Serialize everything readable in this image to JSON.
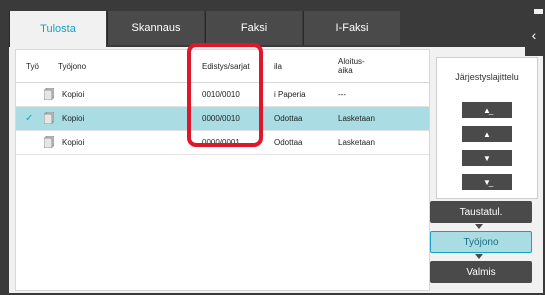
{
  "tabs": [
    "Tulosta",
    "Skannaus",
    "Faksi",
    "I-Faksi"
  ],
  "collapse_icon": "chevron-left-icon",
  "table": {
    "headers": [
      "Työ",
      "Työjono",
      "Edistys/sarjat",
      "ila",
      "Aloitus-\naika"
    ],
    "rows": [
      {
        "job": "Kopioi",
        "progress": "0010/0010",
        "status": "i Paperia",
        "start": "---",
        "selected": false
      },
      {
        "job": "Kopioi",
        "progress": "0000/0010",
        "status": "Odottaa",
        "start": "Lasketaan",
        "selected": true
      },
      {
        "job": "Kopioi",
        "progress": "0000/0001",
        "status": "Odottaa",
        "start": "Lasketaan",
        "selected": false
      }
    ]
  },
  "sort": {
    "title": "Järjestyslajittelu",
    "buttons": [
      "move-top-icon",
      "move-up-icon",
      "move-down-icon",
      "move-bottom-icon"
    ]
  },
  "filters": {
    "background": "Taustatul.",
    "queue": "Työjono",
    "done": "Valmis"
  },
  "colors": {
    "accent": "#1a9fc4",
    "selected_row": "#a9dde3",
    "highlight": "#e0172b"
  }
}
